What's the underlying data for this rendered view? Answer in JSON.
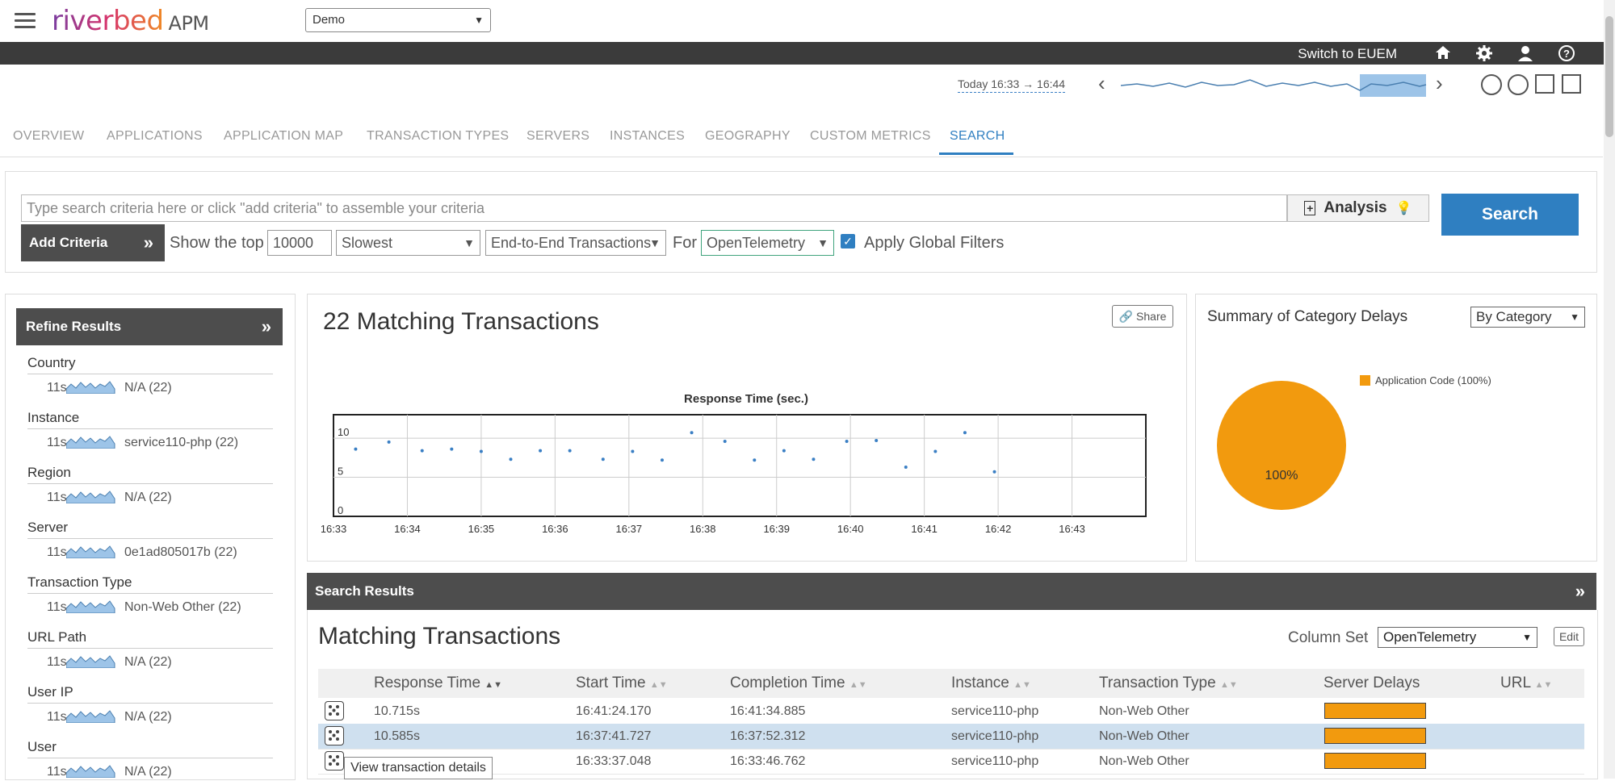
{
  "header": {
    "brand": "riverbed",
    "product": "APM",
    "env_select": "Demo",
    "euem_link": "Switch to EUEM",
    "icons": [
      "home-icon",
      "gear-icon",
      "user-icon",
      "help-icon"
    ]
  },
  "timebar": {
    "range_text": "Today 16:33 → 16:44"
  },
  "tabs": [
    "OVERVIEW",
    "APPLICATIONS",
    "APPLICATION MAP",
    "TRANSACTION TYPES",
    "SERVERS",
    "INSTANCES",
    "GEOGRAPHY",
    "CUSTOM METRICS",
    "SEARCH"
  ],
  "active_tab": "SEARCH",
  "search": {
    "placeholder": "Type search criteria here or click \"add criteria\" to assemble your criteria",
    "analysis_label": "Analysis",
    "search_button": "Search",
    "add_criteria": "Add Criteria",
    "show_top_label": "Show the top",
    "top_count": "10000",
    "sort": "Slowest",
    "scope": "End-to-End Transactions",
    "for_label": "For",
    "for_value": "OpenTelemetry",
    "global_filters_label": "Apply Global Filters"
  },
  "refine": {
    "title": "Refine Results",
    "groups": [
      {
        "title": "Country",
        "dur": "11s",
        "value": "N/A  (22)"
      },
      {
        "title": "Instance",
        "dur": "11s",
        "value": "service110-php  (22)"
      },
      {
        "title": "Region",
        "dur": "11s",
        "value": "N/A  (22)"
      },
      {
        "title": "Server",
        "dur": "11s",
        "value": "0e1ad805017b  (22)"
      },
      {
        "title": "Transaction Type",
        "dur": "11s",
        "value": "Non-Web Other  (22)"
      },
      {
        "title": "URL Path",
        "dur": "11s",
        "value": "N/A  (22)"
      },
      {
        "title": "User IP",
        "dur": "11s",
        "value": "N/A  (22)"
      },
      {
        "title": "User",
        "dur": "11s",
        "value": "N/A  (22)"
      }
    ]
  },
  "matching": {
    "title": "22 Matching Transactions",
    "share_label": "Share"
  },
  "category": {
    "title": "Summary of Category Delays",
    "by_select": "By Category",
    "legend": "Application Code (100%)",
    "slice_label": "100%",
    "color": "#f29a0e"
  },
  "chart_data": [
    {
      "type": "scatter",
      "title": "Response Time (sec.)",
      "xlabel": "",
      "ylabel": "",
      "x_ticks": [
        "16:33",
        "16:34",
        "16:35",
        "16:36",
        "16:37",
        "16:38",
        "16:39",
        "16:40",
        "16:41",
        "16:42",
        "16:43"
      ],
      "y_ticks": [
        "0",
        "5",
        "10"
      ],
      "ylim": [
        0,
        13
      ],
      "x_minutes": [
        33.3,
        33.75,
        34.2,
        34.6,
        35.0,
        35.4,
        35.8,
        36.2,
        36.65,
        37.05,
        37.45,
        37.85,
        38.3,
        38.7,
        39.1,
        39.5,
        39.95,
        40.35,
        40.75,
        41.15,
        41.55,
        41.95
      ],
      "values": [
        8.6,
        9.5,
        8.4,
        8.6,
        8.3,
        7.3,
        8.4,
        8.4,
        7.3,
        8.3,
        7.2,
        10.7,
        9.6,
        7.2,
        8.4,
        7.3,
        9.6,
        9.7,
        6.3,
        8.3,
        10.7,
        5.7
      ],
      "grid": true,
      "color": "#3a7fc4"
    },
    {
      "type": "pie",
      "title": "Summary of Category Delays",
      "categories": [
        "Application Code"
      ],
      "values": [
        100
      ],
      "legend": "top-right"
    }
  ],
  "results": {
    "header": "Search Results",
    "title": "Matching Transactions",
    "column_set_label": "Column Set",
    "column_set": "OpenTelemetry",
    "edit_label": "Edit",
    "columns": [
      "Response Time",
      "Start Time",
      "Completion Time",
      "Instance",
      "Transaction Type",
      "Server Delays",
      "URL"
    ],
    "rows": [
      {
        "response": "10.715s",
        "start": "16:41:24.170",
        "completion": "16:41:34.885",
        "instance": "service110-php",
        "type": "Non-Web Other"
      },
      {
        "response": "10.585s",
        "start": "16:37:41.727",
        "completion": "16:37:52.312",
        "instance": "service110-php",
        "type": "Non-Web Other"
      },
      {
        "response": "",
        "start": "16:33:37.048",
        "completion": "16:33:46.762",
        "instance": "service110-php",
        "type": "Non-Web Other"
      }
    ],
    "tooltip": "View transaction details"
  }
}
